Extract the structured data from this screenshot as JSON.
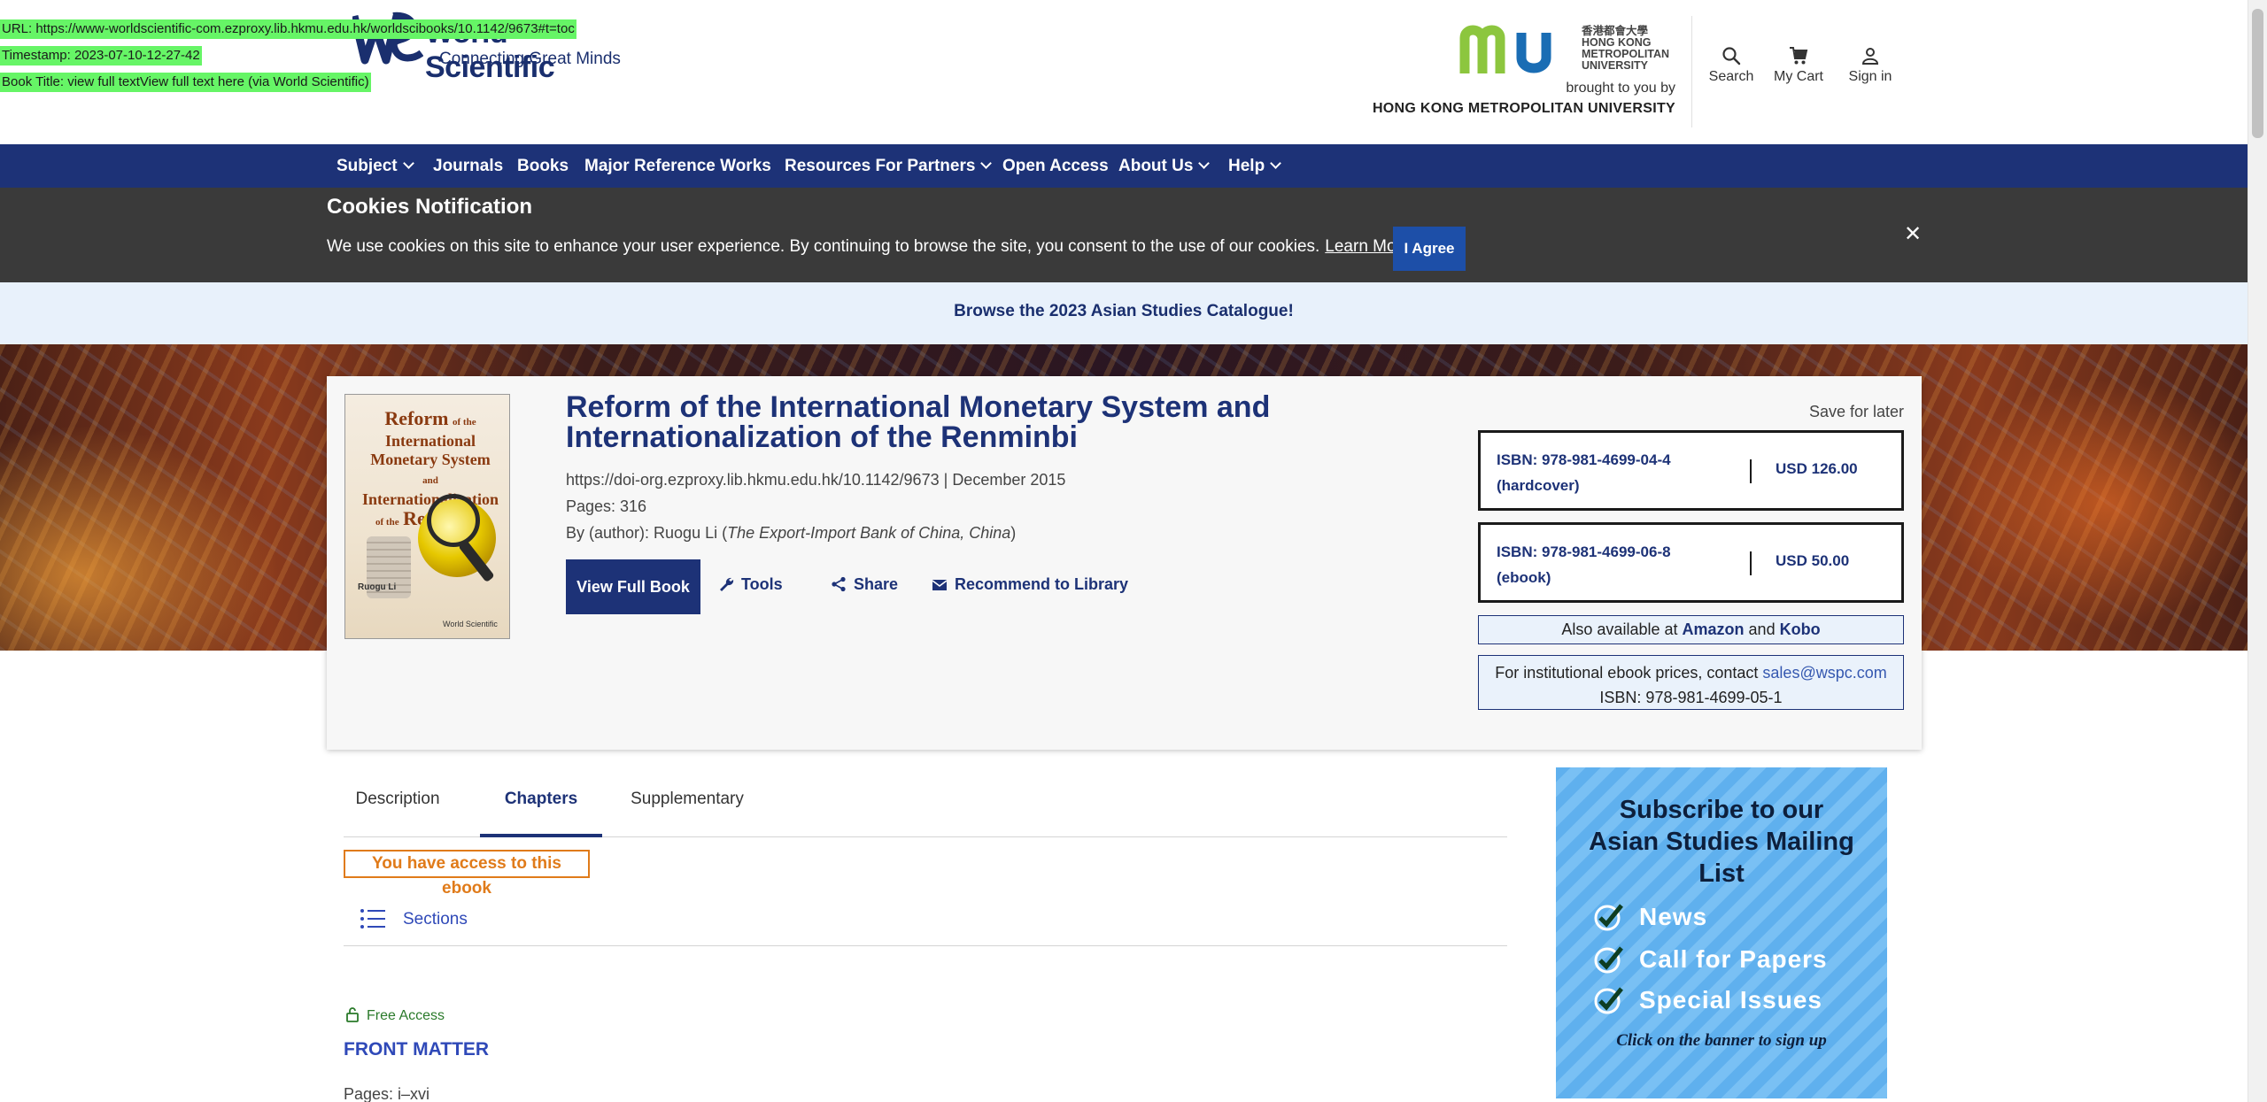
{
  "overlay": {
    "url": "URL: https://www-worldscientific-com.ezproxy.lib.hkmu.edu.hk/worldscibooks/10.1142/9673#t=toc",
    "timestamp": "Timestamp: 2023-07-10-12-27-42",
    "book_title": "Book Title: view full textView full text here (via World Scientific)"
  },
  "header": {
    "logo_name": "World Scientific",
    "logo_tagline": "Connecting Great Minds",
    "partner_logo_text": "香港都會大學 HONG KONG METROPOLITAN UNIVERSITY",
    "partner_uni_lines": [
      "香港都會大學",
      "HONG KONG",
      "METROPOLITAN",
      "UNIVERSITY"
    ],
    "brought_by": "brought to you by",
    "institution": "HONG KONG METROPOLITAN UNIVERSITY",
    "search_label": "Search",
    "cart_label": "My Cart",
    "signin_label": "Sign in"
  },
  "nav": {
    "items": [
      {
        "label": "Subject",
        "dropdown": true
      },
      {
        "label": "Journals",
        "dropdown": false
      },
      {
        "label": "Books",
        "dropdown": false
      },
      {
        "label": "Major Reference Works",
        "dropdown": false
      },
      {
        "label": "Resources For Partners",
        "dropdown": true
      },
      {
        "label": "Open Access",
        "dropdown": false
      },
      {
        "label": "About Us",
        "dropdown": true
      },
      {
        "label": "Help",
        "dropdown": true
      }
    ]
  },
  "cookies": {
    "title": "Cookies Notification",
    "message": "We use cookies on this site to enhance your user experience. By continuing to browse the site, you consent to the use of our cookies.",
    "learn_more": "Learn More",
    "agree": "I Agree",
    "close": "✕"
  },
  "banner": {
    "text": "Browse the 2023 Asian Studies Catalogue!"
  },
  "book": {
    "cover_title_line1": "Reform",
    "cover_title_small1": "of the",
    "cover_title_line2": "International",
    "cover_title_line3": "Monetary System",
    "cover_title_small2": "and",
    "cover_title_line4": "Internationalization",
    "cover_title_small3": "of the",
    "cover_title_line5": "Renminbi",
    "cover_author": "Ruogu Li",
    "cover_publisher": "World Scientific",
    "title": "Reform of the International Monetary System and Internationalization of the Renminbi",
    "doi": "https://doi-org.ezproxy.lib.hkmu.edu.hk/10.1142/9673",
    "date_sep": "|",
    "date": "December 2015",
    "pages": "Pages: 316",
    "author_prefix": "By (author): Ruogu Li (",
    "author_affiliation": "The Export-Import Bank of China, China",
    "author_suffix": ")",
    "view_full_book": "View Full Book",
    "tools": "Tools",
    "share": "Share",
    "recommend": "Recommend to Library",
    "save_later": "Save for later"
  },
  "purchase": {
    "options": [
      {
        "isbn": "ISBN: 978-981-4699-04-4",
        "format": "(hardcover)",
        "price": "USD 126.00"
      },
      {
        "isbn": "ISBN: 978-981-4699-06-8",
        "format": "(ebook)",
        "price": "USD 50.00"
      }
    ],
    "also_prefix": "Also available at",
    "also_amazon": "Amazon",
    "also_and": "and",
    "also_kobo": "Kobo",
    "inst_text": "For institutional ebook prices, contact",
    "inst_email": "sales@wspc.com",
    "inst_isbn": "ISBN: 978-981-4699-05-1"
  },
  "tabs": {
    "items": [
      {
        "label": "Description",
        "active": false
      },
      {
        "label": "Chapters",
        "active": true
      },
      {
        "label": "Supplementary",
        "active": false
      }
    ]
  },
  "content": {
    "access_badge": "You have access to this ebook",
    "sections_label": "Sections",
    "free_access": "Free Access",
    "front_matter": "FRONT MATTER",
    "pages": "Pages: i–xvi"
  },
  "ad": {
    "headline_lines": [
      "Subscribe to our",
      "Asian Studies Mailing",
      "List"
    ],
    "items": [
      "News",
      "Call for Papers",
      "Special Issues"
    ],
    "cta": "Click on the banner to sign up"
  },
  "colors": {
    "brand_navy": "#1d3277",
    "cookie_bg": "#3a3a3a",
    "access_orange": "#e07b1a",
    "link_blue": "#2f49b8",
    "free_green": "#2a7a2a"
  }
}
